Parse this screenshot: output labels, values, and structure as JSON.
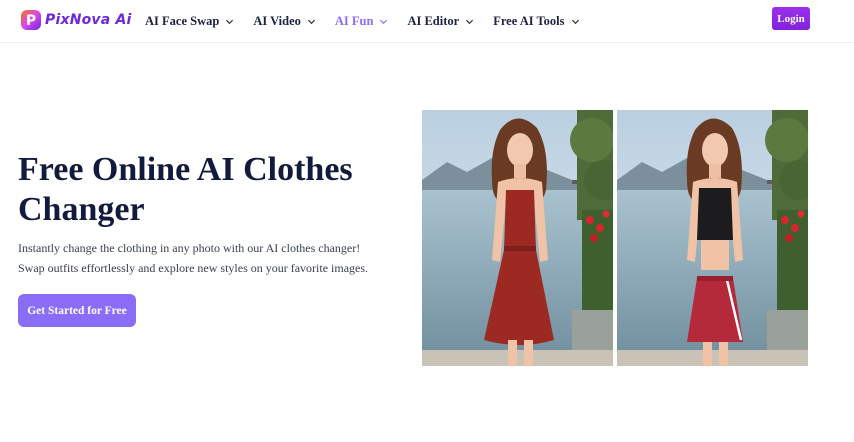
{
  "brand": {
    "name": "PixNova Ai",
    "accent": "#8b6cf6",
    "login_color": "#8a2be2"
  },
  "nav": {
    "items": [
      {
        "label": "AI Face Swap",
        "active": false
      },
      {
        "label": "AI Video",
        "active": false
      },
      {
        "label": "AI Fun",
        "active": true
      },
      {
        "label": "AI Editor",
        "active": false
      },
      {
        "label": "Free AI Tools",
        "active": false
      }
    ],
    "login_label": "Login"
  },
  "hero": {
    "title": "Free Online AI Clothes Changer",
    "description_line1": "Instantly change the clothing in any photo with our AI clothes changer!",
    "description_line2": "Swap outfits effortlessly and explore new styles on your favorite images.",
    "cta_label": "Get Started for Free"
  },
  "images": {
    "before": {
      "outfit": "red sundress",
      "icon": "before-photo"
    },
    "after": {
      "outfit": "black crop top and red skirt",
      "icon": "after-photo"
    }
  }
}
